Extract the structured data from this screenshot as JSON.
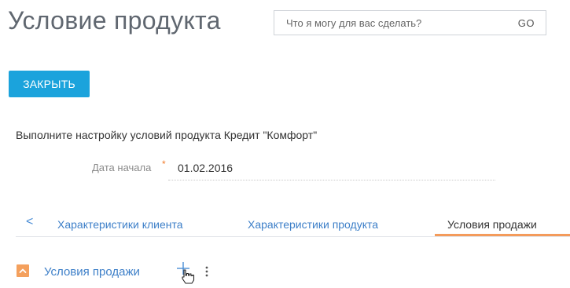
{
  "page": {
    "title": "Условие продукта"
  },
  "search": {
    "placeholder": "Что я могу для вас сделать?",
    "go_label": "GO"
  },
  "actions": {
    "close_label": "ЗАКРЫТЬ"
  },
  "form": {
    "instruction": "Выполните настройку условий продукта Кредит \"Комфорт\"",
    "start_date_label": "Дата начала",
    "required_mark": "*",
    "start_date_value": "01.02.2016"
  },
  "tabs": {
    "prev_glyph": "<",
    "items": [
      {
        "label": "Характеристики клиента",
        "active": false
      },
      {
        "label": "Характеристики продукта",
        "active": false
      },
      {
        "label": "Условия продажи",
        "active": true
      }
    ]
  },
  "detail": {
    "title": "Условия продажи"
  },
  "colors": {
    "accent_blue": "#1ba3dc",
    "link_blue": "#3d7fc8",
    "orange": "#f49b5b"
  },
  "icons": {
    "collapse": "chevron-up-icon",
    "add": "plus-icon",
    "cursor": "hand-pointer-icon",
    "more": "more-vertical-icon"
  }
}
